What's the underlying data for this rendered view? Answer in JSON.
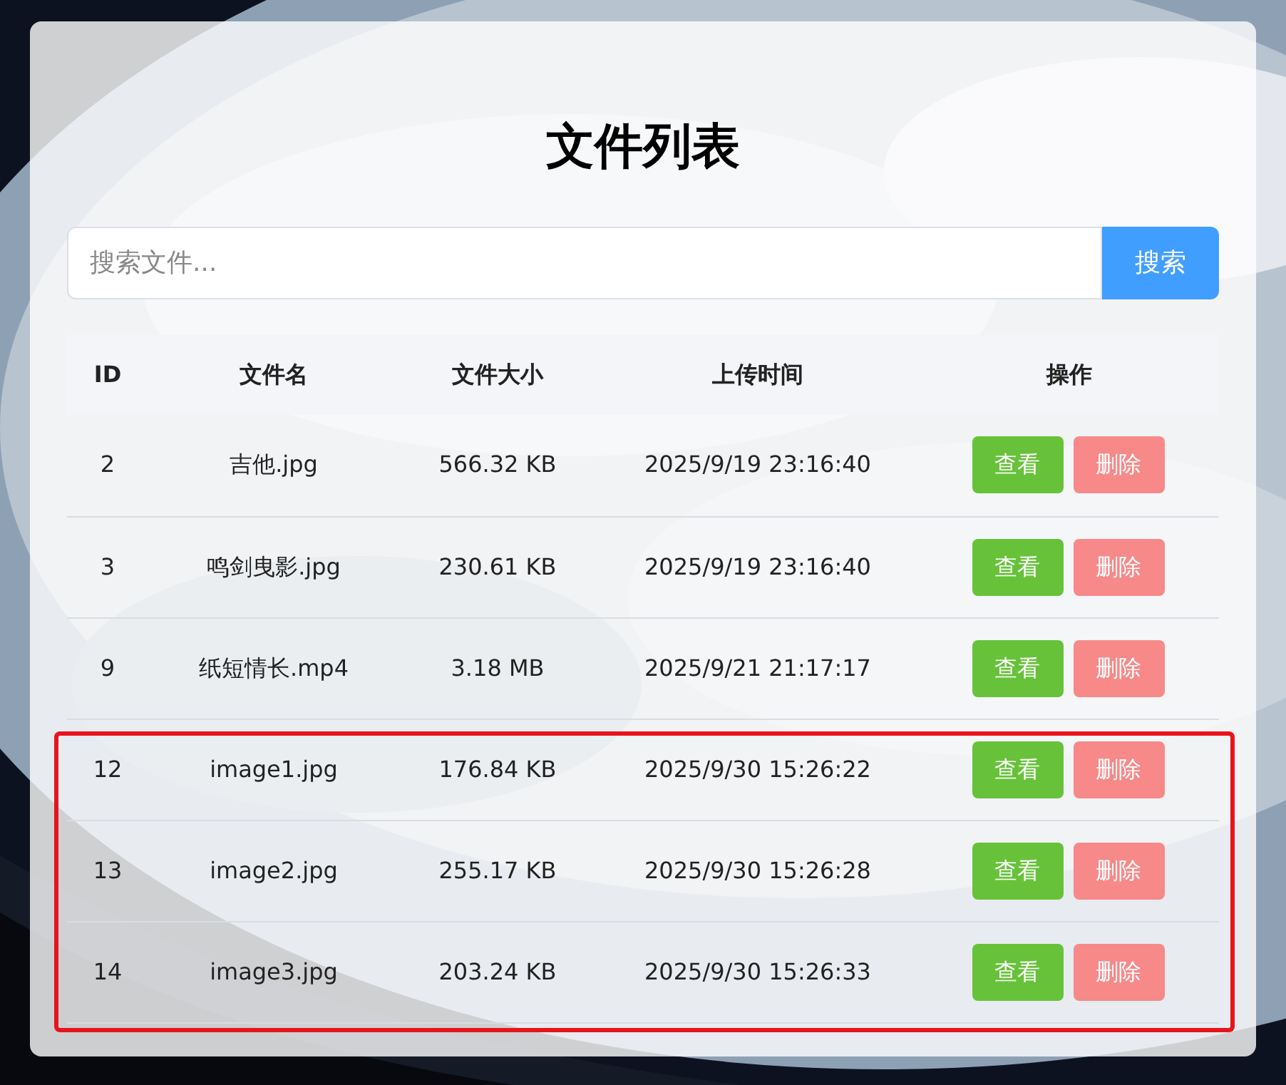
{
  "title": "文件列表",
  "search": {
    "placeholder": "搜索文件...",
    "button": "搜索"
  },
  "table": {
    "columns": [
      "ID",
      "文件名",
      "文件大小",
      "上传时间",
      "操作"
    ],
    "rows": [
      {
        "id": "2",
        "name": "吉他.jpg",
        "size": "566.32 KB",
        "time": "2025/9/19 23:16:40",
        "actions": [
          "查看",
          "删除"
        ],
        "highlighted": false
      },
      {
        "id": "3",
        "name": "鸣剑曳影.jpg",
        "size": "230.61 KB",
        "time": "2025/9/19 23:16:40",
        "actions": [
          "查看",
          "删除"
        ],
        "highlighted": false
      },
      {
        "id": "9",
        "name": "纸短情长.mp4",
        "size": "3.18 MB",
        "time": "2025/9/21 21:17:17",
        "actions": [
          "查看",
          "删除"
        ],
        "highlighted": false
      },
      {
        "id": "12",
        "name": "image1.jpg",
        "size": "176.84 KB",
        "time": "2025/9/30 15:26:22",
        "actions": [
          "查看",
          "删除"
        ],
        "highlighted": true
      },
      {
        "id": "13",
        "name": "image2.jpg",
        "size": "255.17 KB",
        "time": "2025/9/30 15:26:28",
        "actions": [
          "查看",
          "删除"
        ],
        "highlighted": true
      },
      {
        "id": "14",
        "name": "image3.jpg",
        "size": "203.24 KB",
        "time": "2025/9/30 15:26:33",
        "actions": [
          "查看",
          "删除"
        ],
        "highlighted": true
      }
    ]
  }
}
